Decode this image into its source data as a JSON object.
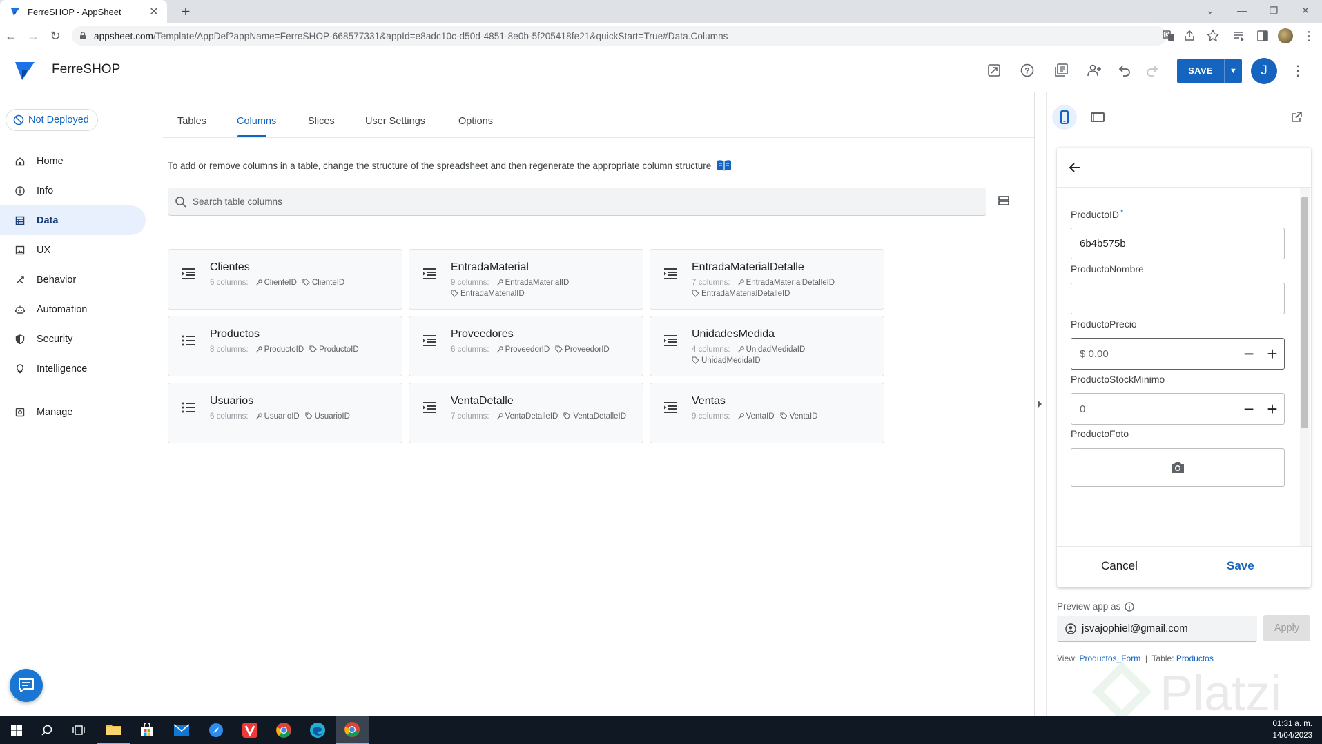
{
  "browser": {
    "tab_title": "FerreSHOP - AppSheet",
    "url_host": "appsheet.com",
    "url_rest": "/Template/AppDef?appName=FerreSHOP-668577331&appId=e8adc10c-d50d-4851-8e0b-5f205418fe21&quickStart=True#Data.Columns"
  },
  "app": {
    "name": "FerreSHOP",
    "save_label": "SAVE",
    "avatar_initial": "J",
    "brand_color": "#1565c0"
  },
  "sidebar": {
    "deploy_status": "Not Deployed",
    "items": [
      {
        "label": "Home",
        "icon": "home-icon"
      },
      {
        "label": "Info",
        "icon": "info-icon"
      },
      {
        "label": "Data",
        "icon": "data-icon",
        "active": true
      },
      {
        "label": "UX",
        "icon": "ux-icon"
      },
      {
        "label": "Behavior",
        "icon": "behavior-icon"
      },
      {
        "label": "Automation",
        "icon": "automation-icon"
      },
      {
        "label": "Security",
        "icon": "shield-icon"
      },
      {
        "label": "Intelligence",
        "icon": "lightbulb-icon"
      }
    ],
    "manage": {
      "label": "Manage",
      "icon": "manage-icon"
    }
  },
  "main": {
    "tabs": [
      {
        "label": "Tables"
      },
      {
        "label": "Columns",
        "active": true
      },
      {
        "label": "Slices"
      },
      {
        "label": "User Settings"
      },
      {
        "label": "Options"
      }
    ],
    "hint": "To add or remove columns in a table, change the structure of the spreadsheet and then regenerate the appropriate column structure",
    "search_placeholder": "Search table columns",
    "tables": [
      {
        "name": "Clientes",
        "count": "6 columns:",
        "key": "ClienteID",
        "label": "ClienteID"
      },
      {
        "name": "EntradaMaterial",
        "count": "9 columns:",
        "key": "EntradaMaterialID",
        "label": "EntradaMaterialID"
      },
      {
        "name": "EntradaMaterialDetalle",
        "count": "7 columns:",
        "key": "EntradaMaterialDetalleID",
        "label": "EntradaMaterialDetalleID"
      },
      {
        "name": "Productos",
        "count": "8 columns:",
        "key": "ProductoID",
        "label": "ProductoID"
      },
      {
        "name": "Proveedores",
        "count": "6 columns:",
        "key": "ProveedorID",
        "label": "ProveedorID"
      },
      {
        "name": "UnidadesMedida",
        "count": "4 columns:",
        "key": "UnidadMedidaID",
        "label": "UnidadMedidaID"
      },
      {
        "name": "Usuarios",
        "count": "6 columns:",
        "key": "UsuarioID",
        "label": "UsuarioID"
      },
      {
        "name": "VentaDetalle",
        "count": "7 columns:",
        "key": "VentaDetalleID",
        "label": "VentaDetalleID"
      },
      {
        "name": "Ventas",
        "count": "9 columns:",
        "key": "VentaID",
        "label": "VentaID"
      }
    ]
  },
  "preview": {
    "fields": [
      {
        "label": "ProductoID",
        "required": "*",
        "value": "6b4b575b"
      },
      {
        "label": "ProductoNombre",
        "value": ""
      },
      {
        "label": "ProductoPrecio",
        "value": "0.00",
        "prefix": "$"
      },
      {
        "label": "ProductoStockMinimo",
        "value": "0"
      },
      {
        "label": "ProductoFoto",
        "value": ""
      }
    ],
    "cancel_label": "Cancel",
    "save_label": "Save",
    "preview_as_label": "Preview app as",
    "email": "jsvajophiel@gmail.com",
    "apply_label": "Apply",
    "view_label": "View:",
    "view_value": "Productos_Form",
    "table_label": "Table:",
    "table_value": "Productos"
  },
  "taskbar": {
    "time": "01:31 a. m.",
    "date": "14/04/2023"
  }
}
